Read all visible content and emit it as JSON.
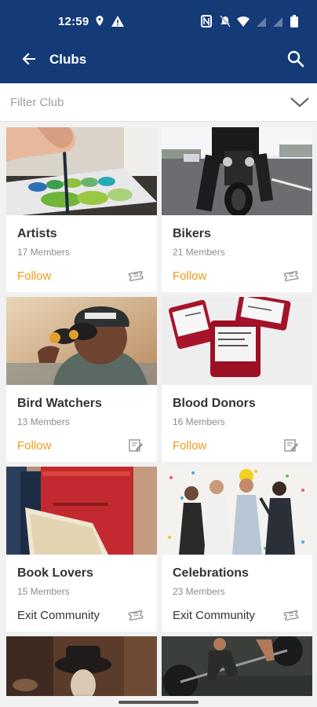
{
  "status_bar": {
    "time": "12:59"
  },
  "toolbar": {
    "title": "Clubs"
  },
  "filter": {
    "placeholder": "Filter Club"
  },
  "clubs": [
    {
      "name": "Artists",
      "members": "17 Members",
      "action": "Follow",
      "action_type": "follow",
      "icon": "ticket-icon"
    },
    {
      "name": "Bikers",
      "members": "21 Members",
      "action": "Follow",
      "action_type": "follow",
      "icon": "ticket-icon"
    },
    {
      "name": "Bird Watchers",
      "members": "13 Members",
      "action": "Follow",
      "action_type": "follow",
      "icon": "edit-note-icon"
    },
    {
      "name": "Blood Donors",
      "members": "16 Members",
      "action": "Follow",
      "action_type": "follow",
      "icon": "edit-note-icon"
    },
    {
      "name": "Book Lovers",
      "members": "15 Members",
      "action": "Exit Community",
      "action_type": "exit",
      "icon": "ticket-icon"
    },
    {
      "name": "Celebrations",
      "members": "23 Members",
      "action": "Exit Community",
      "action_type": "exit",
      "icon": "ticket-icon"
    }
  ],
  "colors": {
    "appbar": "#143a78",
    "follow": "#f29a17"
  }
}
